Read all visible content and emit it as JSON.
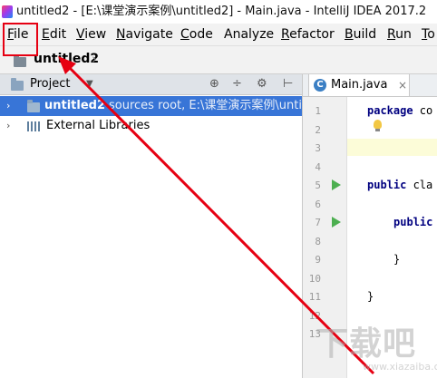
{
  "window": {
    "title": "untitled2 - [E:\\课堂演示案例\\untitled2] - Main.java - IntelliJ IDEA 2017.2"
  },
  "menu": {
    "items": [
      {
        "mn": "F",
        "rest": "ile"
      },
      {
        "mn": "E",
        "rest": "dit"
      },
      {
        "mn": "V",
        "rest": "iew"
      },
      {
        "mn": "N",
        "rest": "avigate"
      },
      {
        "mn": "C",
        "rest": "ode"
      },
      {
        "mn": "",
        "rest": "Analyze"
      },
      {
        "mn": "R",
        "rest": "efactor"
      },
      {
        "mn": "B",
        "rest": "uild"
      },
      {
        "mn": "R",
        "rest": "un"
      },
      {
        "mn": "T",
        "rest": "o"
      }
    ]
  },
  "navbar": {
    "project": "untitled2",
    "chevron": "›"
  },
  "project_panel": {
    "header_label": "Project",
    "header_caret": "▼",
    "tools": [
      "⊕",
      "÷",
      "⚙",
      "⊢"
    ],
    "tree": [
      {
        "arrow": "›",
        "name": "untitled2",
        "meta": "sources root,  E:\\课堂演示案例\\untitled2"
      },
      {
        "arrow": "›",
        "label": "External Libraries"
      }
    ]
  },
  "editor": {
    "tab_label": "Main.java",
    "tab_icon_letter": "C",
    "tab_close": "×",
    "line_numbers": [
      "1",
      "2",
      "3",
      "4",
      "5",
      "6",
      "7",
      "8",
      "9",
      "10",
      "11",
      "12",
      "13"
    ],
    "code": [
      {
        "line": 1,
        "kw": "package",
        "rest": " co"
      },
      {
        "line": 5,
        "kw": "public",
        "rest": " cla"
      },
      {
        "line": 7,
        "kw": "public",
        "rest": ""
      },
      {
        "line": 9,
        "kw": "",
        "rest": "}"
      },
      {
        "line": 11,
        "kw": "",
        "rest": "}"
      }
    ]
  },
  "watermark": {
    "big": "下载吧",
    "small": "www.xiazaiba.com"
  },
  "colors": {
    "highlight_red": "#e60012",
    "selection_blue": "#3875d7",
    "run_green": "#4caf50"
  }
}
